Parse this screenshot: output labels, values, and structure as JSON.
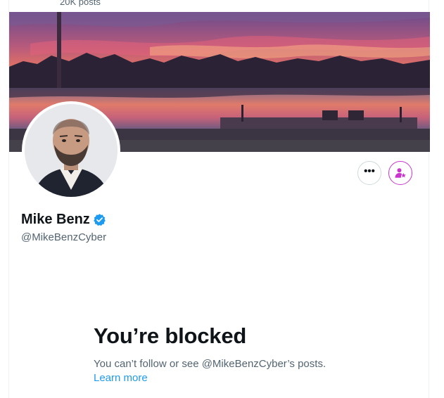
{
  "header": {
    "post_count": "20K posts"
  },
  "profile": {
    "display_name": "Mike Benz",
    "handle": "@MikeBenzCyber",
    "verified": true
  },
  "actions": {
    "more_icon": "more-horizontal-icon",
    "subscribe_icon": "subscribe-person-star-icon"
  },
  "blocked": {
    "title": "You’re blocked",
    "message": "You can’t follow or see @MikeBenzCyber’s posts.",
    "learn_more": "Learn more"
  },
  "colors": {
    "accent_blue": "#1d9bf0",
    "subscribe_magenta": "#c936cc",
    "text_primary": "#0f1419",
    "text_secondary": "#536471",
    "border": "#cfd9de"
  }
}
